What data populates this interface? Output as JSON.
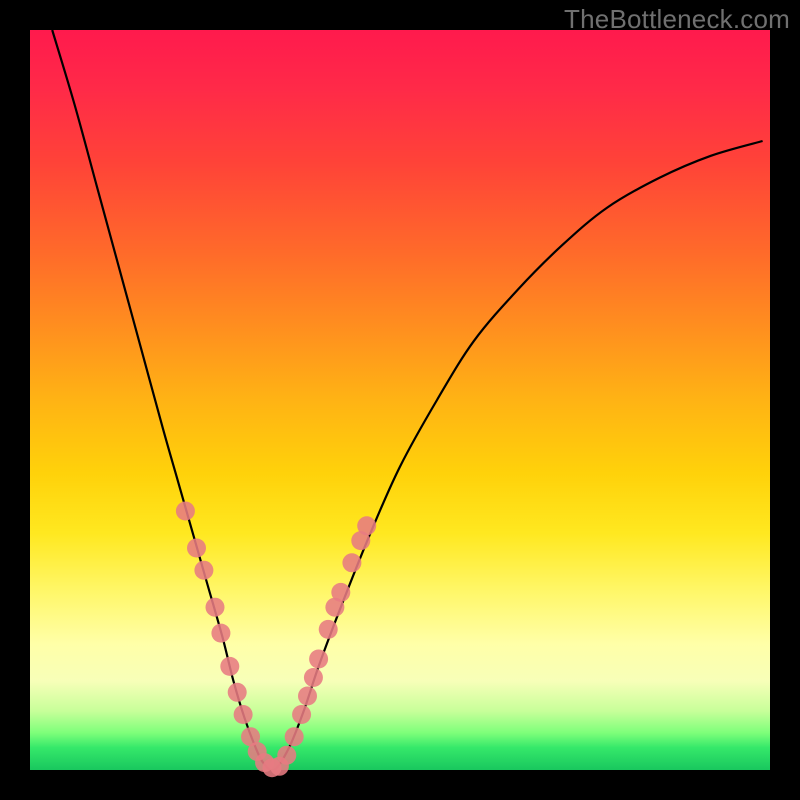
{
  "watermark": "TheBottleneck.com",
  "chart_data": {
    "type": "line",
    "title": "",
    "xlabel": "",
    "ylabel": "",
    "xlim": [
      0,
      100
    ],
    "ylim": [
      0,
      100
    ],
    "series": [
      {
        "name": "curve",
        "x": [
          3,
          6,
          9,
          12,
          15,
          18,
          20,
          22,
          24,
          26,
          27.5,
          29,
          30.5,
          31.5,
          33,
          35,
          37,
          39,
          42,
          46,
          50,
          55,
          60,
          66,
          72,
          78,
          85,
          92,
          99
        ],
        "values": [
          100,
          90,
          79,
          68,
          57,
          46,
          39,
          32,
          25,
          18,
          12,
          7,
          3,
          1,
          0,
          3,
          8,
          14,
          22,
          32,
          41,
          50,
          58,
          65,
          71,
          76,
          80,
          83,
          85
        ]
      }
    ],
    "markers": [
      {
        "x": 21.0,
        "y": 35.0
      },
      {
        "x": 22.5,
        "y": 30.0
      },
      {
        "x": 23.5,
        "y": 27.0
      },
      {
        "x": 25.0,
        "y": 22.0
      },
      {
        "x": 25.8,
        "y": 18.5
      },
      {
        "x": 27.0,
        "y": 14.0
      },
      {
        "x": 28.0,
        "y": 10.5
      },
      {
        "x": 28.8,
        "y": 7.5
      },
      {
        "x": 29.8,
        "y": 4.5
      },
      {
        "x": 30.7,
        "y": 2.5
      },
      {
        "x": 31.7,
        "y": 1.0
      },
      {
        "x": 32.7,
        "y": 0.3
      },
      {
        "x": 33.7,
        "y": 0.5
      },
      {
        "x": 34.7,
        "y": 2.0
      },
      {
        "x": 35.7,
        "y": 4.5
      },
      {
        "x": 36.7,
        "y": 7.5
      },
      {
        "x": 37.5,
        "y": 10.0
      },
      {
        "x": 38.3,
        "y": 12.5
      },
      {
        "x": 39.0,
        "y": 15.0
      },
      {
        "x": 40.3,
        "y": 19.0
      },
      {
        "x": 41.2,
        "y": 22.0
      },
      {
        "x": 42.0,
        "y": 24.0
      },
      {
        "x": 43.5,
        "y": 28.0
      },
      {
        "x": 44.7,
        "y": 31.0
      },
      {
        "x": 45.5,
        "y": 33.0
      }
    ],
    "marker_color": "#e77b82",
    "curve_color": "#000000"
  }
}
